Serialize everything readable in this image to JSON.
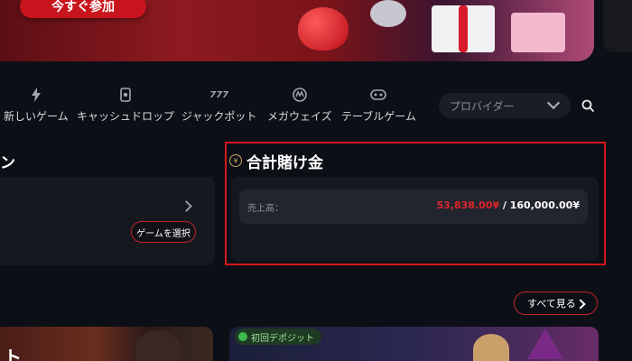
{
  "hero": {
    "join_label": "今すぐ参加"
  },
  "nav": {
    "items": [
      {
        "label": "新しいゲーム",
        "icon": "lightning-icon"
      },
      {
        "label": "キャッシュドロップ",
        "icon": "cash-drop-icon"
      },
      {
        "label": "ジャックポット",
        "icon": "jackpot-777-icon"
      },
      {
        "label": "メガウェイズ",
        "icon": "megaways-icon"
      },
      {
        "label": "テーブルゲーム",
        "icon": "table-games-icon"
      }
    ],
    "provider_placeholder": "プロバイダー"
  },
  "left_panel": {
    "title_fragment": "ン",
    "select_game_label": "ゲームを選択"
  },
  "total_wager": {
    "title": "合計賭け金",
    "sales_label": "売上高：",
    "current": "53,838.00¥",
    "separator": " / ",
    "goal": "160,000.00¥"
  },
  "see_all_label": "すべて見る",
  "promo": {
    "left_text": "ト",
    "deposit_badge": "初回デポジット"
  },
  "colors": {
    "accent": "#d3161c",
    "background": "#0d0f16",
    "card": "#161820",
    "current_value": "#e0252c"
  }
}
